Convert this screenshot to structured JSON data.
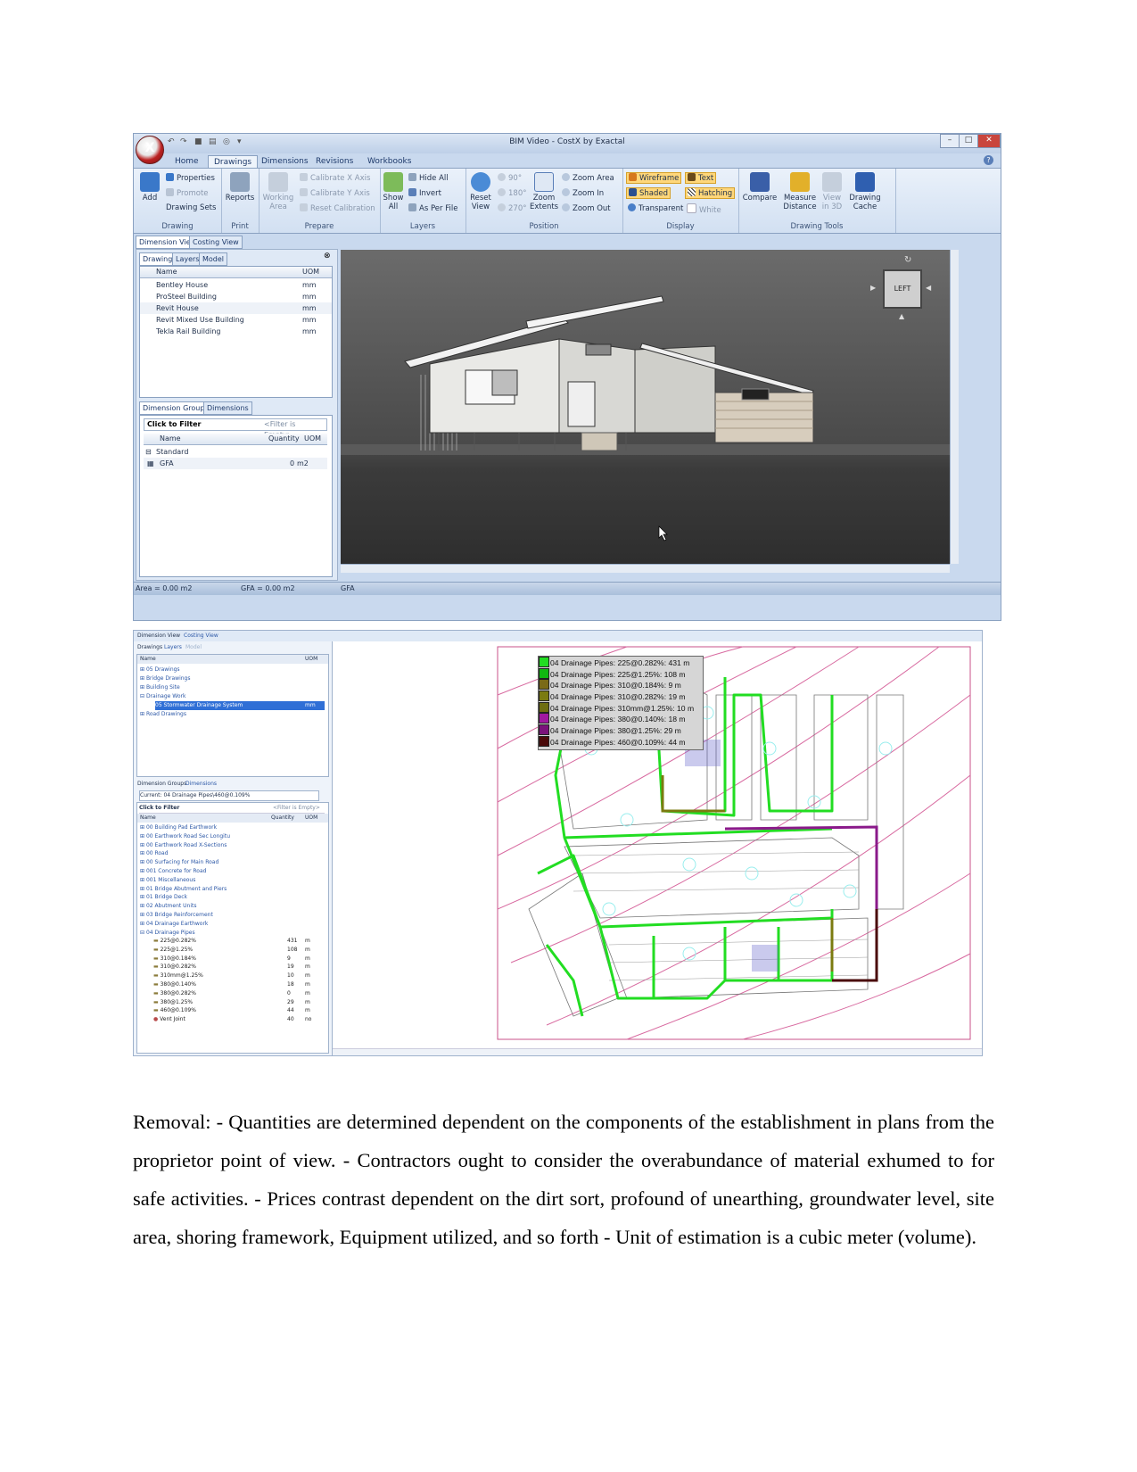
{
  "shot1": {
    "window_title": "BIM Video - CostX by Exactal",
    "app_orb": "X",
    "tabs": [
      "Home",
      "Drawings",
      "Dimensions",
      "Revisions",
      "Workbooks"
    ],
    "active_tab": "Drawings",
    "ribbon": {
      "drawing": {
        "label": "Drawing",
        "add": "Add",
        "properties": "Properties",
        "promote": "Promote",
        "drawing_sets": "Drawing Sets"
      },
      "print": {
        "label": "Print",
        "reports": "Reports"
      },
      "prepare": {
        "label": "Prepare",
        "working_area": "Working Area",
        "calibrate_x": "Calibrate X Axis",
        "calibrate_y": "Calibrate Y Axis",
        "reset_calibration": "Reset Calibration"
      },
      "layers": {
        "label": "Layers",
        "show_all": "Show All",
        "hide_all": "Hide All",
        "invert": "Invert",
        "as_per_file": "As Per File"
      },
      "position": {
        "label": "Position",
        "reset_view": "Reset View",
        "rot90": "90°",
        "rot180": "180°",
        "rot270": "270°",
        "zoom_extents": "Zoom Extents",
        "zoom_area": "Zoom Area",
        "zoom_in": "Zoom In",
        "zoom_out": "Zoom Out"
      },
      "display": {
        "label": "Display",
        "wireframe": "Wireframe",
        "shaded": "Shaded",
        "transparent": "Transparent",
        "text": "Text",
        "hatching": "Hatching",
        "white": "White"
      },
      "drawing_tools": {
        "label": "Drawing Tools",
        "compare": "Compare",
        "measure_distance": "Measure Distance",
        "view_in_3d": "View in 3D",
        "drawing_cache": "Drawing Cache"
      }
    },
    "view_tabs": [
      "Dimension View",
      "Costing View"
    ],
    "panel_tabs": [
      "Drawings",
      "Layers",
      "Model"
    ],
    "drawings_headers": [
      "Name",
      "UOM"
    ],
    "drawings": [
      {
        "name": "Bentley House",
        "uom": "mm"
      },
      {
        "name": "ProSteel Building",
        "uom": "mm"
      },
      {
        "name": "Revit House",
        "uom": "mm"
      },
      {
        "name": "Revit Mixed Use Building",
        "uom": "mm"
      },
      {
        "name": "Tekla Rail Building",
        "uom": "mm"
      }
    ],
    "dim_tabs": [
      "Dimension Groups",
      "Dimensions"
    ],
    "filter_label": "Click to Filter",
    "filter_hint": "<Filter is Empty>",
    "dim_headers": [
      "Name",
      "Quantity",
      "UOM"
    ],
    "dim_group": "Standard",
    "dim_rows": [
      {
        "name": "GFA",
        "quantity": "0",
        "uom": "m2"
      }
    ],
    "viewcube_label": "LEFT",
    "status": [
      "Area = 0.00 m2",
      "GFA = 0.00 m2",
      "GFA"
    ]
  },
  "shot2": {
    "view_tabs": [
      "Dimension View",
      "Costing View"
    ],
    "panel_tabs": [
      "Drawings",
      "Layers",
      "Model"
    ],
    "tree_headers": [
      "Name",
      "UOM"
    ],
    "tree": [
      {
        "name": "05 Drawings",
        "uom": ""
      },
      {
        "name": "Bridge Drawings",
        "uom": ""
      },
      {
        "name": "Building Site",
        "uom": ""
      },
      {
        "name": "Drainage Work",
        "uom": ""
      },
      {
        "name": "05 Stormwater Drainage System",
        "uom": "mm"
      },
      {
        "name": "Road Drawings",
        "uom": ""
      }
    ],
    "dim_tabs": [
      "Dimension Groups",
      "Dimensions"
    ],
    "current": "Current: 04 Drainage Pipes\\460@0.109%",
    "filter_label": "Click to Filter",
    "filter_hint": "<Filter is Empty>",
    "dim_headers": [
      "Name",
      "Quantity",
      "UOM"
    ],
    "groups": [
      "00 Building Pad Earthwork",
      "00 Earthwork Road Sec Longitu",
      "00 Earthwork Road X-Sections",
      "00 Road",
      "00 Surfacing for Main Road",
      "001 Concrete for Road",
      "001 Miscellaneous",
      "01 Bridge Abutment and Piers",
      "01 Bridge Deck",
      "02 Abutment Units",
      "03 Bridge Reinforcement",
      "04 Drainage Earthwork",
      "04 Drainage Pipes"
    ],
    "pipes": [
      {
        "name": "225@0.282%",
        "qty": "431",
        "uom": "m"
      },
      {
        "name": "225@1.25%",
        "qty": "108",
        "uom": "m"
      },
      {
        "name": "310@0.184%",
        "qty": "9",
        "uom": "m"
      },
      {
        "name": "310@0.282%",
        "qty": "19",
        "uom": "m"
      },
      {
        "name": "310mm@1.25%",
        "qty": "10",
        "uom": "m"
      },
      {
        "name": "380@0.140%",
        "qty": "18",
        "uom": "m"
      },
      {
        "name": "380@0.282%",
        "qty": "0",
        "uom": "m"
      },
      {
        "name": "380@1.25%",
        "qty": "29",
        "uom": "m"
      },
      {
        "name": "460@0.109%",
        "qty": "44",
        "uom": "m"
      },
      {
        "name": "Vent Joint",
        "qty": "40",
        "uom": "no"
      }
    ],
    "legend": [
      {
        "text": "04 Drainage Pipes: 225@0.282%: 431 m",
        "color": "#22dd22"
      },
      {
        "text": "04 Drainage Pipes: 225@1.25%: 108 m",
        "color": "#11b811"
      },
      {
        "text": "04 Drainage Pipes: 310@0.184%: 9 m",
        "color": "#7a6a18"
      },
      {
        "text": "04 Drainage Pipes: 310@0.282%: 19 m",
        "color": "#7b7b10"
      },
      {
        "text": "04 Drainage Pipes: 310mm@1.25%: 10 m",
        "color": "#6e6e12"
      },
      {
        "text": "04 Drainage Pipes: 380@0.140%: 18 m",
        "color": "#a019a0"
      },
      {
        "text": "04 Drainage Pipes: 380@1.25%: 29 m",
        "color": "#7a127a"
      },
      {
        "text": "04 Drainage Pipes: 460@0.109%: 44 m",
        "color": "#4a0a0a"
      }
    ]
  },
  "paragraph": "Removal: - Quantities are determined dependent on the components of the establishment in plans from the proprietor point of view. - Contractors ought to consider the overabundance of material exhumed to for safe activities. - Prices contrast dependent on the dirt sort, profound of unearthing, groundwater level, site area, shoring framework, Equipment utilized, and so forth - Unit of estimation is a cubic meter (volume)."
}
